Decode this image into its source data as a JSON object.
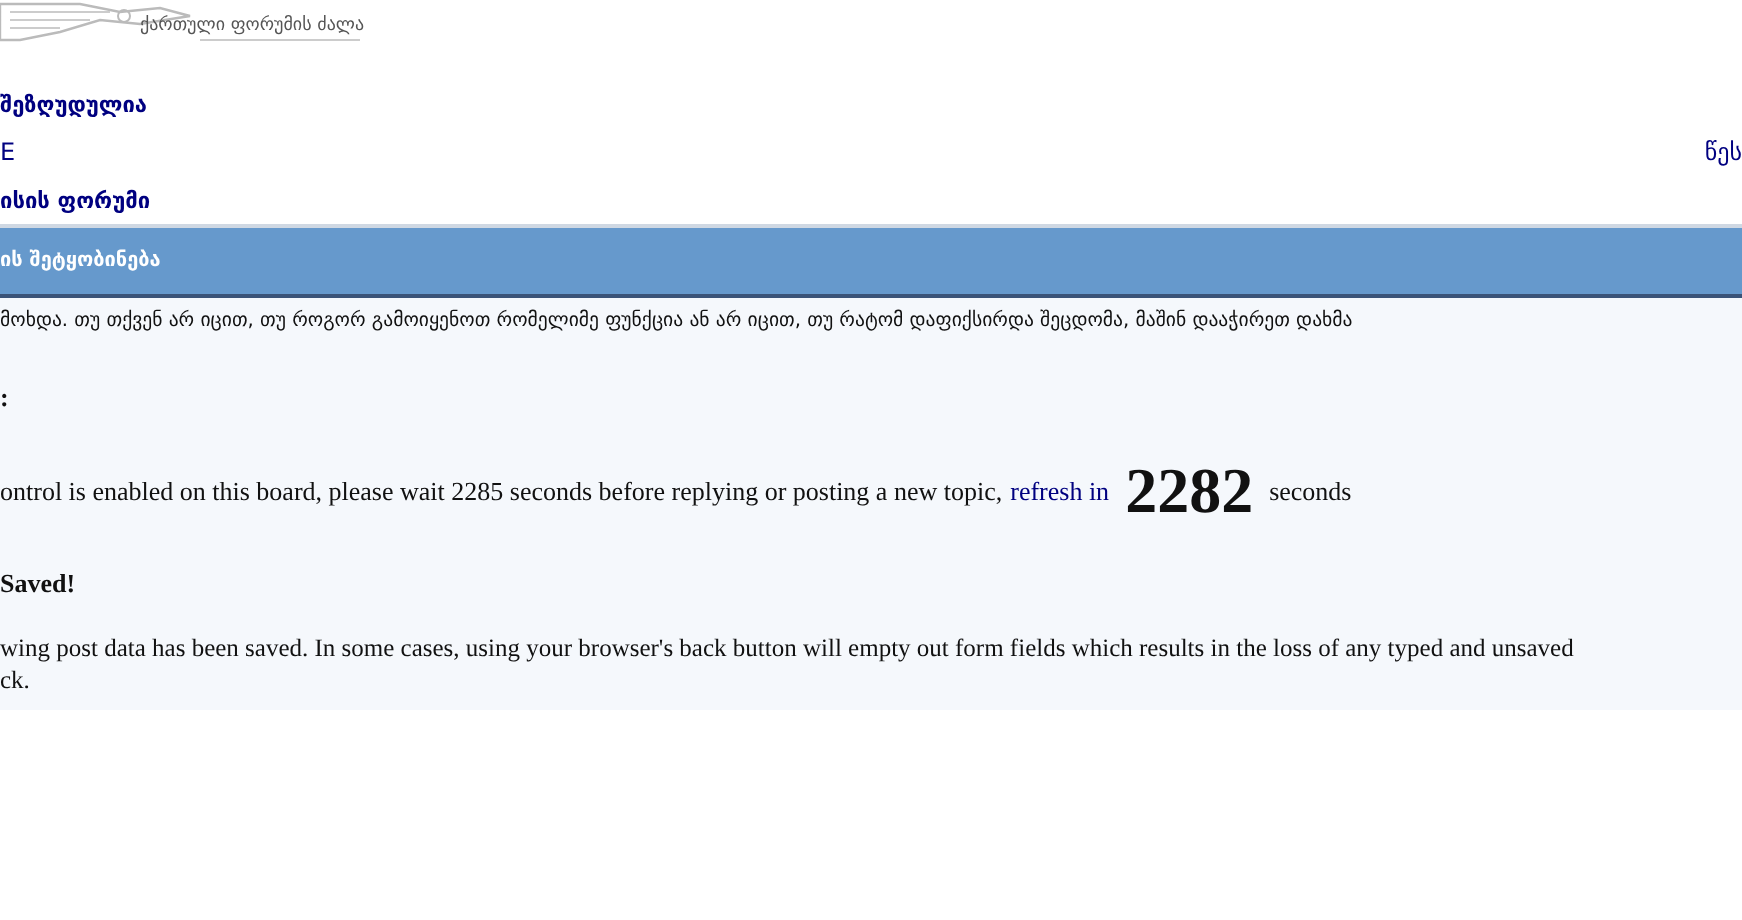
{
  "logo": {
    "tagline": "ქართული ფორუმის ძალა"
  },
  "nav": {
    "restricted": "შეზღუდულია",
    "left_link": "E",
    "right_link": "წეს",
    "forum": "ისის ფორუმი"
  },
  "message": {
    "title": "ის შეტყობინება",
    "intro": "მოხდა. თუ თქვენ არ იცით, თუ როგორ გამოიყენოთ რომელიმე ფუნქცია ან არ იცით, თუ რატომ დაფიქსირდა შეცდომა, მაშინ დააჭირეთ დახმა",
    "label": ":",
    "flood": {
      "text": "ontrol is enabled on this board, please wait 2285 seconds before replying or posting a new topic,",
      "link": "refresh in",
      "count": "2282",
      "unit": "seconds"
    },
    "saved_title": "Saved!",
    "saved_lines": [
      "wing post data has been saved. In some cases, using your browser's back button will empty out form fields which results in the loss of any typed and unsaved",
      "ck."
    ]
  }
}
